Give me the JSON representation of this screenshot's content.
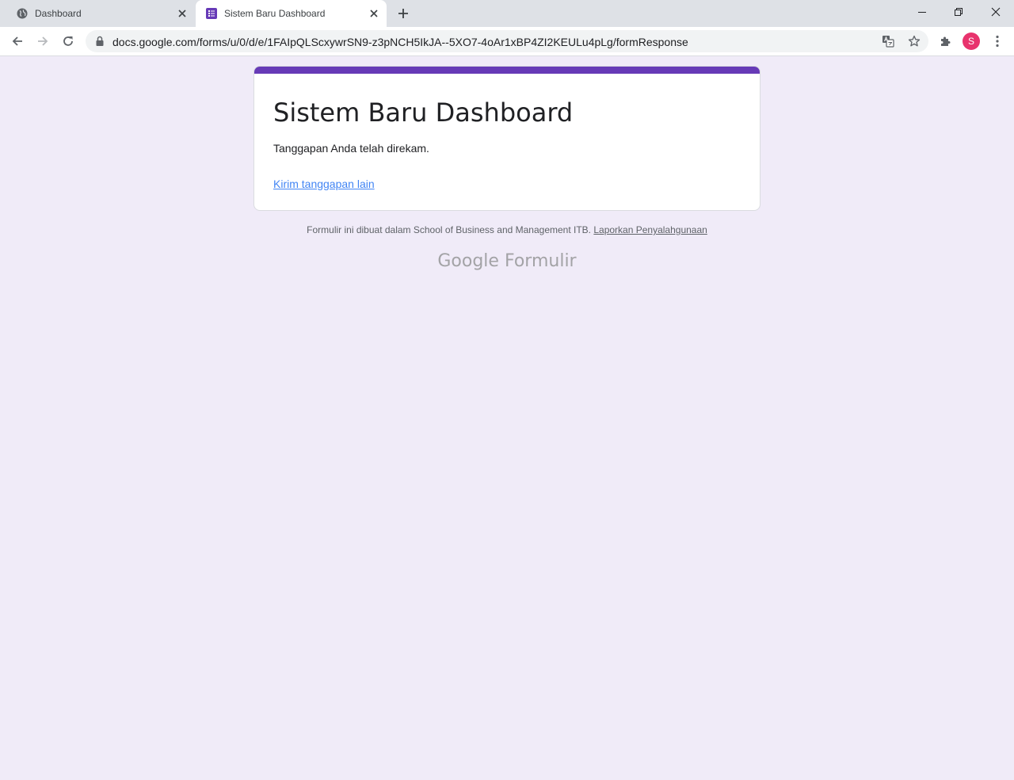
{
  "browser": {
    "tabs": [
      {
        "title": "Dashboard",
        "active": false
      },
      {
        "title": "Sistem Baru Dashboard",
        "active": true
      }
    ],
    "url": "docs.google.com/forms/u/0/d/e/1FAIpQLScxywrSN9-z3pNCH5IkJA--5XO7-4oAr1xBP4ZI2KEULu4pLg/formResponse",
    "profile_initial": "S",
    "colors": {
      "profile": "#e8336d",
      "tabbar": "#dee1e6"
    }
  },
  "form": {
    "title": "Sistem Baru Dashboard",
    "confirmation": "Tanggapan Anda telah direkam.",
    "another_response": "Kirim tanggapan lain",
    "accent_color": "#673ab7",
    "background_color": "#f0ebf8"
  },
  "footer": {
    "note": "Formulir ini dibuat dalam School of Business and Management ITB.",
    "abuse_link": "Laporkan Penyalahgunaan",
    "brand_google": "Google",
    "brand_product": "Formulir"
  }
}
